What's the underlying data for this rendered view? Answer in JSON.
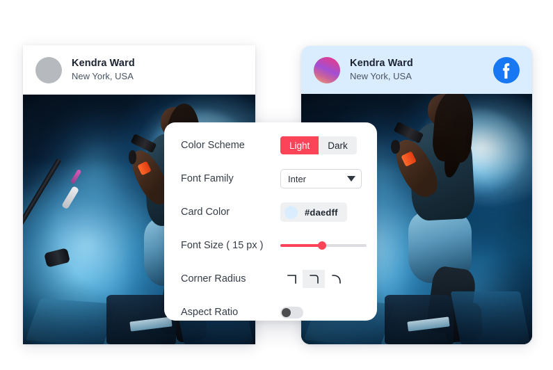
{
  "cards": [
    {
      "id": "card-light-plain",
      "avatar_type": "plain-gray-avatar",
      "name": "Kendra Ward",
      "location": "New York, USA",
      "header_bg": "#ffffff",
      "corner_radius": "0px",
      "social_icon": null,
      "photo_alt": "Singer performing on stage with blue smoke"
    },
    {
      "id": "card-light-blue",
      "avatar_type": "gradient-avatar",
      "name": "Kendra Ward",
      "location": "New York, USA",
      "header_bg": "#daedff",
      "corner_radius": "13px",
      "social_icon": "facebook-icon",
      "photo_alt": "Singer performing on stage with blue smoke"
    }
  ],
  "settings": {
    "color_scheme": {
      "label": "Color Scheme",
      "options": [
        "Light",
        "Dark"
      ],
      "selected": "Light",
      "active_color": "#fb4457",
      "inactive_color": "#eeeff1"
    },
    "font_family": {
      "label": "Font Family",
      "value": "Inter",
      "icon": "chevron-down-icon"
    },
    "card_color": {
      "label": "Card Color",
      "value": "#daedff",
      "swatch_color": "#daedff"
    },
    "font_size": {
      "label": "Font Size ( 15 px )",
      "value": 15,
      "unit": "px",
      "percent": 48,
      "fill_color": "#fb4457",
      "track_color": "#dcdde0"
    },
    "corner_radius": {
      "label": "Corner Radius",
      "options": [
        "sharp-corner-icon",
        "small-radius-corner-icon",
        "large-radius-corner-icon"
      ],
      "selected_index": 1
    },
    "aspect_ratio": {
      "label": "Aspect Ratio",
      "enabled": false
    }
  },
  "colors": {
    "accent": "#fb4457",
    "card_blue": "#daedff",
    "facebook_blue": "#1877F2",
    "page_bg": "#ffffff"
  }
}
